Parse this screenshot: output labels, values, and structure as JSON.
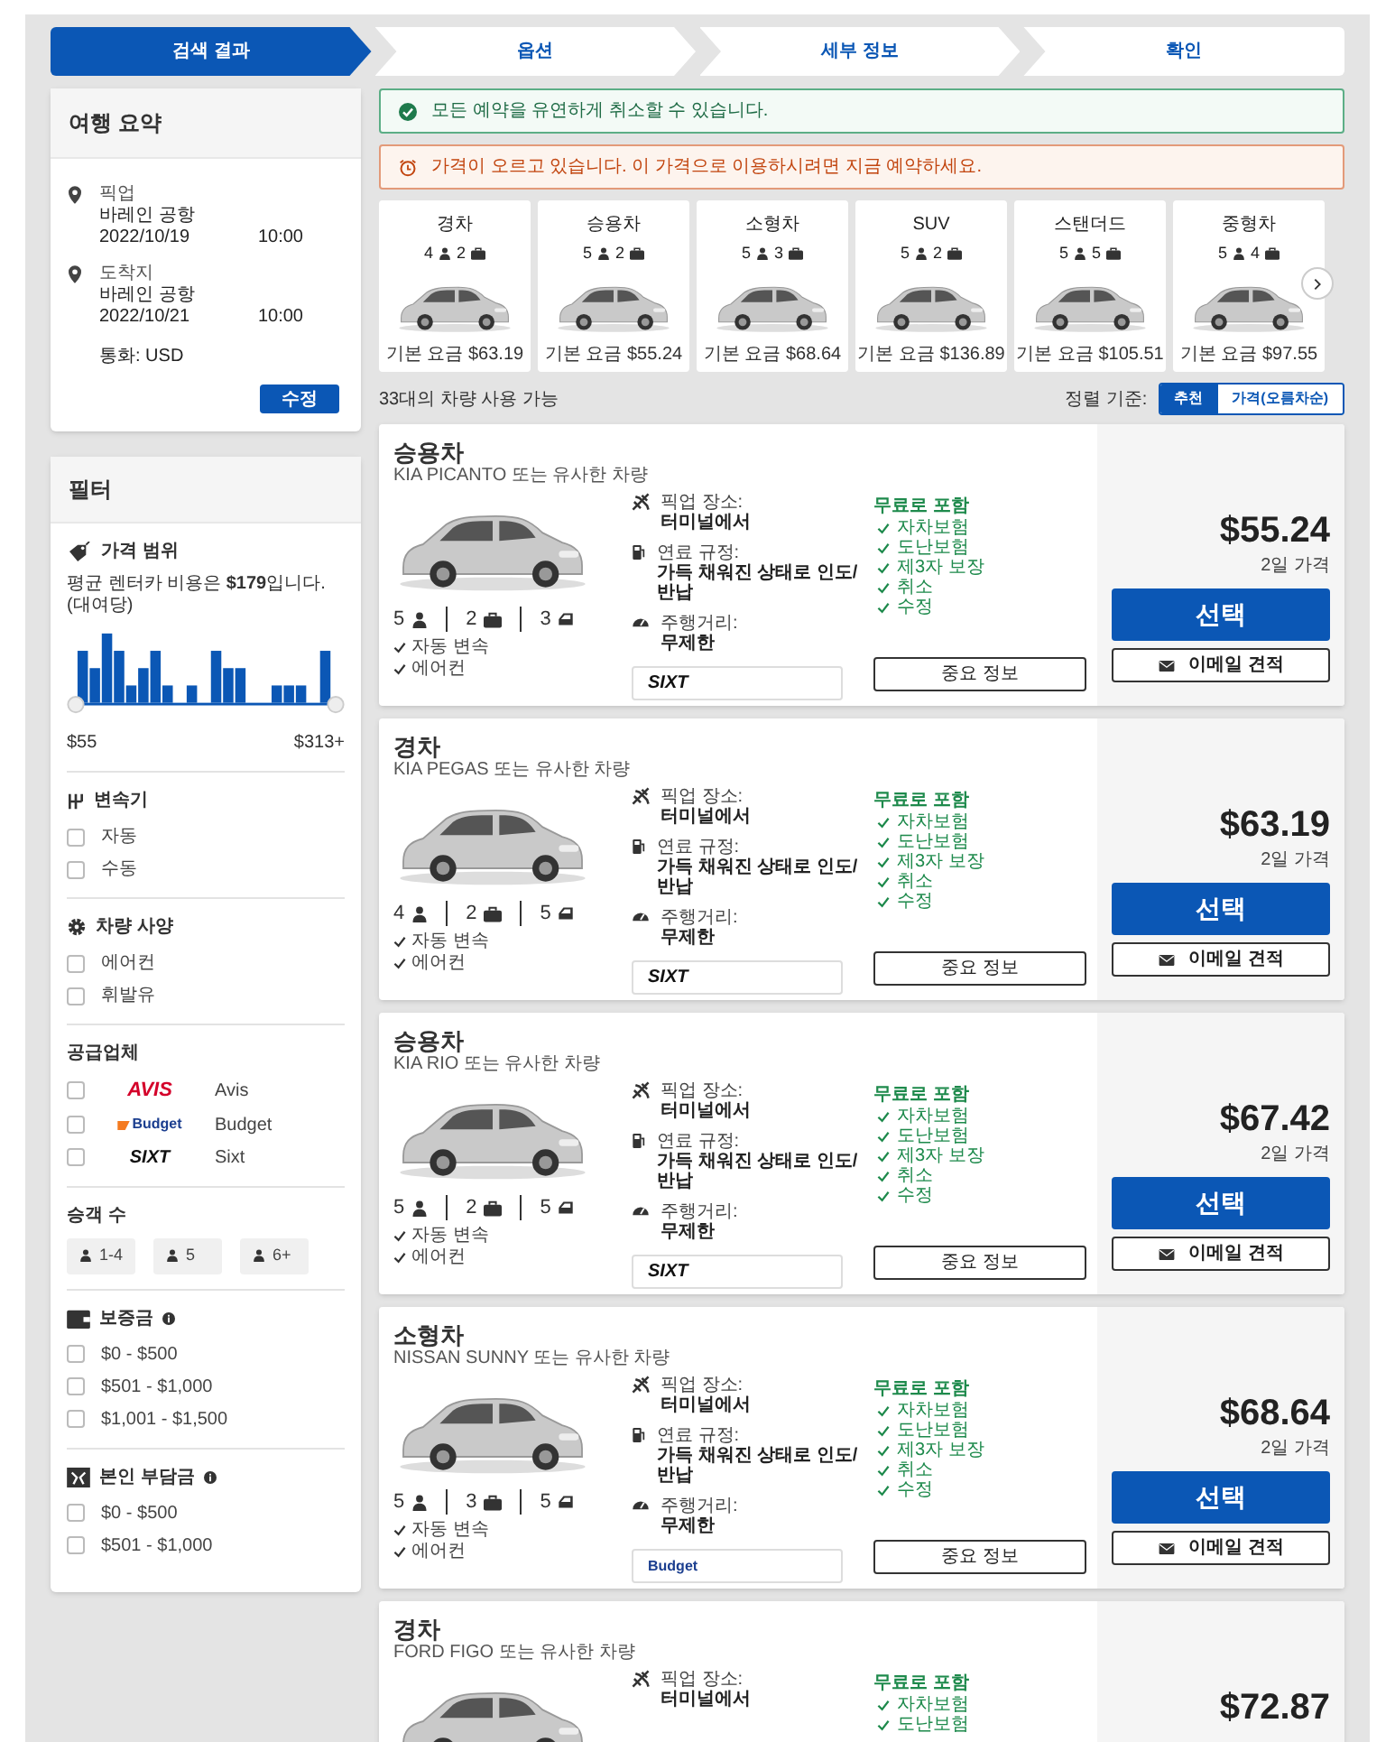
{
  "steps": [
    {
      "label": "검색 결과",
      "selected": true
    },
    {
      "label": "옵션",
      "selected": false
    },
    {
      "label": "세부 정보",
      "selected": false
    },
    {
      "label": "확인",
      "selected": false
    }
  ],
  "trip_summary": {
    "title": "여행 요약",
    "pickup": {
      "label": "픽업",
      "location": "바레인 공항",
      "date": "2022/10/19",
      "time": "10:00"
    },
    "dropoff": {
      "label": "도착지",
      "location": "바레인 공항",
      "date": "2022/10/21",
      "time": "10:00"
    },
    "currency": "통화: USD",
    "edit_button": "수정"
  },
  "filters": {
    "title": "필터",
    "price_range": {
      "title": "가격 범위",
      "note": "평균 렌터카 비용은 **$179**입니다. (대여당)",
      "min": "$55",
      "max": "$313+"
    },
    "transmission": {
      "title": "변속기",
      "options": [
        {
          "label": "자동",
          "checked": false
        },
        {
          "label": "수동",
          "checked": false
        }
      ]
    },
    "features": {
      "title": "차량 사양",
      "options": [
        {
          "label": "에어컨",
          "checked": false
        },
        {
          "label": "휘발유",
          "checked": false
        }
      ]
    },
    "suppliers": {
      "title": "공급업체",
      "options": [
        {
          "kind": "avis",
          "logo": "AVIS",
          "label": "Avis",
          "checked": false
        },
        {
          "kind": "budget",
          "logo": "Budget",
          "label": "Budget",
          "checked": false
        },
        {
          "kind": "sixt",
          "logo": "SIXT",
          "label": "Sixt",
          "checked": false
        }
      ]
    },
    "passengers": {
      "title": "승객 수",
      "options": [
        {
          "label": "1-4",
          "selected": false
        },
        {
          "label": "5",
          "selected": false
        },
        {
          "label": "6+",
          "selected": false
        }
      ]
    },
    "deposit": {
      "title": "보증금",
      "options": [
        {
          "label": "$0 - $500",
          "checked": false
        },
        {
          "label": "$501 - $1,000",
          "checked": false
        },
        {
          "label": "$1,001 - $1,500",
          "checked": false
        }
      ]
    },
    "excess": {
      "title": "본인 부담금",
      "options": [
        {
          "label": "$0 - $500",
          "checked": false
        },
        {
          "label": "$501 - $1,000",
          "checked": false
        }
      ]
    }
  },
  "notices": [
    {
      "kind": "success",
      "text": "모든 예약을 유연하게 취소할 수 있습니다."
    },
    {
      "kind": "warning",
      "text": "가격이 오르고 있습니다. 이 가격으로 이용하시려면 지금 예약하세요."
    }
  ],
  "categories": [
    {
      "name": "경차",
      "seats": "4",
      "bags": "2",
      "price": "기본 요금 $63.19"
    },
    {
      "name": "승용차",
      "seats": "5",
      "bags": "2",
      "price": "기본 요금 $55.24"
    },
    {
      "name": "소형차",
      "seats": "5",
      "bags": "3",
      "price": "기본 요금 $68.64"
    },
    {
      "name": "SUV",
      "seats": "5",
      "bags": "2",
      "price": "기본 요금 $136.89"
    },
    {
      "name": "스탠더드",
      "seats": "5",
      "bags": "5",
      "price": "기본 요금 $105.51"
    },
    {
      "name": "중형차",
      "seats": "5",
      "bags": "4",
      "price": "기본 요금 $97.55"
    }
  ],
  "results": {
    "count": "33대의 차량 사용 가능",
    "sort_label": "정렬 기준:",
    "sort_options": [
      {
        "label": "추천",
        "selected": true
      },
      {
        "label": "가격(오름차순)",
        "selected": false
      }
    ]
  },
  "cars": [
    {
      "category": "승용차",
      "model": "KIA PICANTO 또는 유사한 차량",
      "seats": "5",
      "bags": "2",
      "doors": "3",
      "features": [
        "자동 변속",
        "에어컨"
      ],
      "pickup_label": "픽업 장소:",
      "pickup_value": "터미널에서",
      "fuel_label": "연료 규정:",
      "fuel_value": "가득 채워진 상태로 인도/반납",
      "mileage_label": "주행거리:",
      "mileage_value": "무제한",
      "vendor": {
        "kind": "sixt",
        "logo": "SIXT"
      },
      "included_title": "무료로 포함",
      "included": [
        "자차보험",
        "도난보험",
        "제3자 보장",
        "취소",
        "수정"
      ],
      "info_button": "중요 정보",
      "price": "$55.24",
      "price_note": "2일 가격",
      "select_button": "선택",
      "email_button": "이메일 견적"
    },
    {
      "category": "경차",
      "model": "KIA PEGAS 또는 유사한 차량",
      "seats": "4",
      "bags": "2",
      "doors": "5",
      "features": [
        "자동 변속",
        "에어컨"
      ],
      "pickup_label": "픽업 장소:",
      "pickup_value": "터미널에서",
      "fuel_label": "연료 규정:",
      "fuel_value": "가득 채워진 상태로 인도/반납",
      "mileage_label": "주행거리:",
      "mileage_value": "무제한",
      "vendor": {
        "kind": "sixt",
        "logo": "SIXT"
      },
      "included_title": "무료로 포함",
      "included": [
        "자차보험",
        "도난보험",
        "제3자 보장",
        "취소",
        "수정"
      ],
      "info_button": "중요 정보",
      "price": "$63.19",
      "price_note": "2일 가격",
      "select_button": "선택",
      "email_button": "이메일 견적"
    },
    {
      "category": "승용차",
      "model": "KIA RIO 또는 유사한 차량",
      "seats": "5",
      "bags": "2",
      "doors": "5",
      "features": [
        "자동 변속",
        "에어컨"
      ],
      "pickup_label": "픽업 장소:",
      "pickup_value": "터미널에서",
      "fuel_label": "연료 규정:",
      "fuel_value": "가득 채워진 상태로 인도/반납",
      "mileage_label": "주행거리:",
      "mileage_value": "무제한",
      "vendor": {
        "kind": "sixt",
        "logo": "SIXT"
      },
      "included_title": "무료로 포함",
      "included": [
        "자차보험",
        "도난보험",
        "제3자 보장",
        "취소",
        "수정"
      ],
      "info_button": "중요 정보",
      "price": "$67.42",
      "price_note": "2일 가격",
      "select_button": "선택",
      "email_button": "이메일 견적"
    },
    {
      "category": "소형차",
      "model": "NISSAN SUNNY 또는 유사한 차량",
      "seats": "5",
      "bags": "3",
      "doors": "5",
      "features": [
        "자동 변속",
        "에어컨"
      ],
      "pickup_label": "픽업 장소:",
      "pickup_value": "터미널에서",
      "fuel_label": "연료 규정:",
      "fuel_value": "가득 채워진 상태로 인도/반납",
      "mileage_label": "주행거리:",
      "mileage_value": "무제한",
      "vendor": {
        "kind": "budget",
        "logo": "Budget"
      },
      "included_title": "무료로 포함",
      "included": [
        "자차보험",
        "도난보험",
        "제3자 보장",
        "취소",
        "수정"
      ],
      "info_button": "중요 정보",
      "price": "$68.64",
      "price_note": "2일 가격",
      "select_button": "선택",
      "email_button": "이메일 견적"
    },
    {
      "category": "경차",
      "model": "FORD FIGO 또는 유사한 차량",
      "pickup_label": "픽업 장소:",
      "pickup_value": "터미널에서",
      "included_title": "무료로 포함",
      "included": [
        "자차보험",
        "도난보험"
      ],
      "price": "$72.87"
    }
  ]
}
